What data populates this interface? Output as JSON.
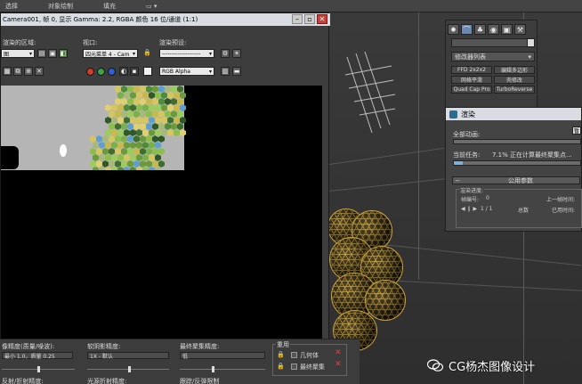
{
  "topbar": {
    "menus": [
      "选择",
      "对象绘制",
      "填充",
      ""
    ]
  },
  "framebuffer": {
    "title": "Camera001, 帧 0, 显示 Gamma: 2.2, RGBA 颜色 16 位/通道 (1:1)",
    "area_label": "渲染的区域:",
    "area_value": "图",
    "viewport_label": "视口:",
    "viewport_value": "四元菜单 4 - Cam",
    "preset_label": "渲染预设:",
    "preset_value": "--------------------",
    "channel_value": "RGB Alpha"
  },
  "command_panel": {
    "modifier_list": "修改器列表",
    "buttons": [
      "FFD 2x2x2",
      "编辑多边形",
      "网格平滑",
      "壳修改",
      "Quad Cap Pro",
      "TurboReverse"
    ]
  },
  "progress": {
    "title": "渲染",
    "total_label": "全部动画:",
    "total_fraction": 0.0,
    "current_label": "当前任务:",
    "current_text": "7.1% 正在计算最终聚集点...",
    "current_fraction": 0.071,
    "pause_label": "暂",
    "section_label": "公用参数",
    "progress_label": "渲染进度:",
    "frame_label": "帧编号:",
    "frame_value": "0",
    "prev_frame_label": "上一帧时间:",
    "total_count_label": "总数",
    "elapsed_label": "已用时间:",
    "frame_counter": "1 / 1"
  },
  "bottom": {
    "precision_label": "像精度(质量/噪波):",
    "precision_value": "最小 1.0，质量 0.25",
    "soft_shadow_label": "软阴影精度:",
    "soft_shadow_value": "1X - 默认",
    "fg_precision_label": "最终聚集精度:",
    "fg_precision_value": "低",
    "reflect_label": "反射/折射精度:",
    "light_refract_label": "光源折射精度:",
    "trace_label": "跟踪/反弹限制",
    "reuse_label": "重用",
    "geometry_label": "几何体",
    "final_gather_label": "最终聚集"
  },
  "watermark": {
    "text": "CG杨杰图像设计"
  },
  "colors": {
    "accent": "#7fb0d8",
    "close": "#c9403a",
    "honey": "#c9a23a"
  }
}
